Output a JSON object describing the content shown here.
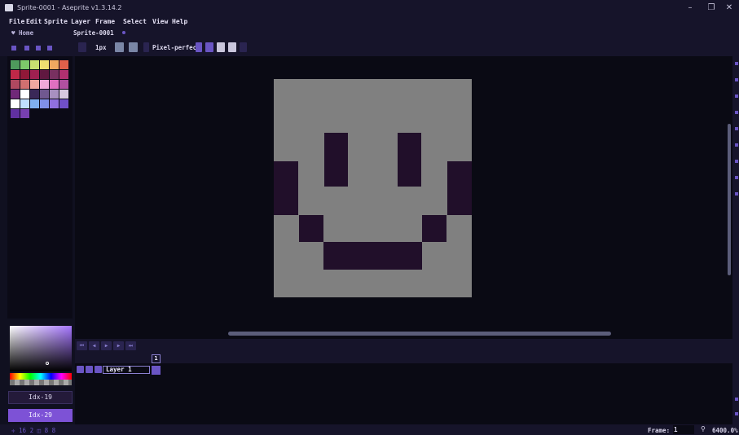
{
  "window": {
    "title": "Sprite-0001 - Aseprite v1.3.14.2",
    "minimize_glyph": "–",
    "maximize_glyph": "❐",
    "close_glyph": "✕"
  },
  "menu": {
    "items": [
      "File",
      "Edit",
      "Sprite",
      "Layer",
      "Frame",
      "Select",
      "View",
      "Help"
    ]
  },
  "tabs": {
    "home": "♥ Home",
    "sprite": "Sprite-0001"
  },
  "context_bar": {
    "brush_size": "1px",
    "pixel_perfect": "Pixel-perfect"
  },
  "palette": {
    "swatches": [
      "#4e9a5c",
      "#7cc86a",
      "#c8e070",
      "#f0e070",
      "#f0a860",
      "#e0604a",
      "#c02848",
      "#901838",
      "#a02050",
      "#601840",
      "#783060",
      "#b03070",
      "#b04860",
      "#d07070",
      "#f0a8a0",
      "#f0a8d8",
      "#e070c0",
      "#b050a0",
      "#702878",
      "#ffffff",
      "#3a2858",
      "#705890",
      "#a890c0",
      "#d8c8e0",
      "#ffffff",
      "#c0e0ff",
      "#80b0f0",
      "#8090e8",
      "#9070e0",
      "#7050c8",
      "#6030a0",
      "#7840b0"
    ],
    "fg_label": "Idx-19",
    "bg_label": "Idx-29"
  },
  "sprite": {
    "background": "#808080",
    "pixel_color": "#210f2a"
  },
  "timeline": {
    "frame_number": "1",
    "layer_name": "Layer 1"
  },
  "status": {
    "left_text": "✛ 16 2  ◫ 8 8",
    "frame_label": "Frame:",
    "frame_value": "1",
    "zoom_icon": "⚲",
    "zoom": "6400.0%"
  }
}
